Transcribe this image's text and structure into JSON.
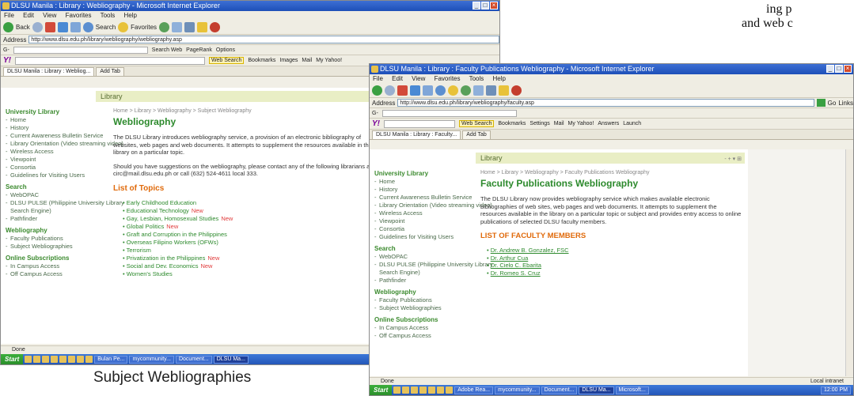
{
  "doc": {
    "line1": "ing p",
    "line2": "and web c",
    "caption": "Subject Webliographies"
  },
  "win1": {
    "title": "DLSU Manila : Library : Webliography - Microsoft Internet Explorer",
    "menu": [
      "File",
      "Edit",
      "View",
      "Favorites",
      "Tools",
      "Help"
    ],
    "toolbar": {
      "back": "Back",
      "search": "Search",
      "favorites": "Favorites"
    },
    "address_label": "Address",
    "address_value": "http://www.dlsu.edu.ph/library/webliography/webliography.asp",
    "google_label": "G-",
    "google_buttons": [
      "Search Web",
      "PageRank",
      "Options"
    ],
    "yahoo_search_btn": "Web Search",
    "yahoo_items": [
      "Bookmarks",
      "Images",
      "Mail",
      "My Yahoo!"
    ],
    "tabs": [
      "DLSU Manila : Library : Webliog...",
      "Add Tab"
    ],
    "library_label": "Library",
    "nav": {
      "university_library": "University Library",
      "university_items": [
        "Home",
        "History",
        "Current Awareness Bulletin Service",
        "Library Orientation (Video streaming video)",
        "Wireless Access",
        "Viewpoint",
        "Consortia",
        "Guidelines for Visiting Users"
      ],
      "search": "Search",
      "search_items": [
        "WebOPAC",
        "DLSU PULSE (Philippine University Library Search Engine)",
        "Pathfinder"
      ],
      "webliography": "Webliography",
      "webliography_items": [
        "Faculty Publications",
        "Subject Webliographies"
      ],
      "online_subscriptions": "Online Subscriptions",
      "online_items": [
        "In Campus Access",
        "Off Campus Access"
      ]
    },
    "breadcrumb": "Home > Library > Webliography > Subject Webliography",
    "page_title": "Webliography",
    "para1": "The DLSU Library introduces webliography service, a provision of an electronic bibliography of websites, web pages and web documents. It attempts to supplement the resources available in the library on a particular topic.",
    "para2": "Should you have suggestions on the webliography, please contact any of the following librarians at circ@mail.dlsu.edu.ph or call (632) 524-4611 local 333.",
    "topics_heading": "List of Topics",
    "topics": [
      {
        "label": "Early Childhood Education",
        "badge": ""
      },
      {
        "label": "Educational Technology",
        "badge": "New"
      },
      {
        "label": "Gay, Lesbian, Homosexual Studies",
        "badge": "New"
      },
      {
        "label": "Global Politics",
        "badge": "New"
      },
      {
        "label": "Graft and Corruption in the Philippines",
        "badge": ""
      },
      {
        "label": "Overseas Filipino Workers (OFWs)",
        "badge": ""
      },
      {
        "label": "Terrorism",
        "badge": ""
      },
      {
        "label": "Privatization in the Philippines",
        "badge": "New"
      },
      {
        "label": "Social and Dev. Economics",
        "badge": "New"
      },
      {
        "label": "Women's Studies",
        "badge": ""
      }
    ],
    "status": "Done",
    "taskbar": {
      "start": "Start",
      "items": [
        "Bulan Pe...",
        "mycommunity...",
        "Document...",
        "DLSU Ma..."
      ]
    }
  },
  "win2": {
    "title": "DLSU Manila : Library : Faculty Publications Webliography - Microsoft Internet Explorer",
    "menu": [
      "File",
      "Edit",
      "View",
      "Favorites",
      "Tools",
      "Help"
    ],
    "address_label": "Address",
    "address_value": "http://www.dlsu.edu.ph/library/webliography/faculty.asp",
    "go": "Go",
    "links": "Links",
    "google_label": "G-",
    "yahoo_search_btn": "Web Search",
    "yahoo_items": [
      "Bookmarks",
      "Settings",
      "Mail",
      "My Yahoo!",
      "Answers",
      "Launch"
    ],
    "tabs": [
      "DLSU Manila : Library : Faculty...",
      "Add Tab"
    ],
    "library_label": "Library",
    "nav": {
      "university_library": "University Library",
      "university_items": [
        "Home",
        "History",
        "Current Awareness Bulletin Service",
        "Library Orientation (Video streaming video)",
        "Wireless Access",
        "Viewpoint",
        "Consortia",
        "Guidelines for Visiting Users"
      ],
      "search": "Search",
      "search_items": [
        "WebOPAC",
        "DLSU PULSE (Philippine University Library Search Engine)",
        "Pathfinder"
      ],
      "webliography": "Webliography",
      "webliography_items": [
        "Faculty Publications",
        "Subject Webliographies"
      ],
      "online_subscriptions": "Online Subscriptions",
      "online_items": [
        "In Campus Access",
        "Off Campus Access"
      ]
    },
    "breadcrumb": "Home > Library > Webliography > Faculty Publications Webliography",
    "page_title": "Faculty Publications Webliography",
    "para1": "The DLSU Library now provides webliography service which makes available electronic bibliographies of web sites, web pages and web documents. It attempts to supplement the resources available in the library on a particular topic or subject and provides entry access to online publications of selected DLSU faculty members.",
    "faculty_heading": "LIST OF FACULTY MEMBERS",
    "faculty": [
      "Dr. Andrew B. Gonzalez, FSC",
      "Dr. Arthur Cua",
      "Dr. Cielo C. Ebarita",
      "Dr. Romeo S. Cruz"
    ],
    "status": "Done",
    "status_right": "Local intranet",
    "taskbar": {
      "start": "Start",
      "items": [
        "Adobe Rea...",
        "mycommunity...",
        "Document...",
        "DLSU Ma...",
        "Microsoft..."
      ],
      "clock": "12:00 PM"
    }
  }
}
